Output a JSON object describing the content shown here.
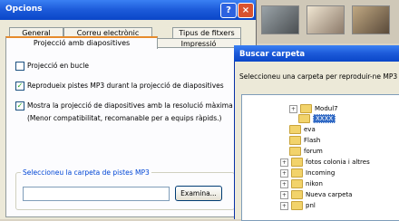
{
  "opcions": {
    "title": "Opcions",
    "help_label": "?",
    "close_label": "×",
    "tabs": [
      "General",
      "Correu electrònic",
      "Tipus de fitxers",
      "Projecció amb diapositives",
      "Impressió"
    ],
    "options": [
      {
        "label": "Projecció en bucle",
        "checked": false
      },
      {
        "label": "Reprodueix pistes MP3 durant la projecció de diapositives",
        "checked": true
      },
      {
        "label": "Mostra la projecció de diapositives amb la resolució màxima",
        "checked": true
      }
    ],
    "note": "(Menor compatibilitat, recomanable per a equips ràpids.)",
    "group_title": "Seleccioneu la carpeta de pistes MP3",
    "browse_label": "Examina..."
  },
  "dialog": {
    "title": "Buscar carpeta",
    "message": "Seleccioneu una carpeta per reproduir-ne MP3",
    "tree": [
      {
        "label": "Modul7",
        "expander": "+"
      },
      {
        "label": "XXXX",
        "expander": "",
        "selected": true
      },
      {
        "label": "eva",
        "expander": ""
      },
      {
        "label": "Flash",
        "expander": ""
      },
      {
        "label": "forum",
        "expander": ""
      },
      {
        "label": "fotos colonia i altres",
        "expander": "+"
      },
      {
        "label": "Incoming",
        "expander": "+"
      },
      {
        "label": "nikon",
        "expander": "+"
      },
      {
        "label": "Nueva carpeta",
        "expander": "+"
      },
      {
        "label": "pnl",
        "expander": "+"
      }
    ]
  },
  "icons": {
    "help": "help-icon",
    "close": "close-icon",
    "folder": "folder-icon",
    "check": "checkmark-icon"
  }
}
